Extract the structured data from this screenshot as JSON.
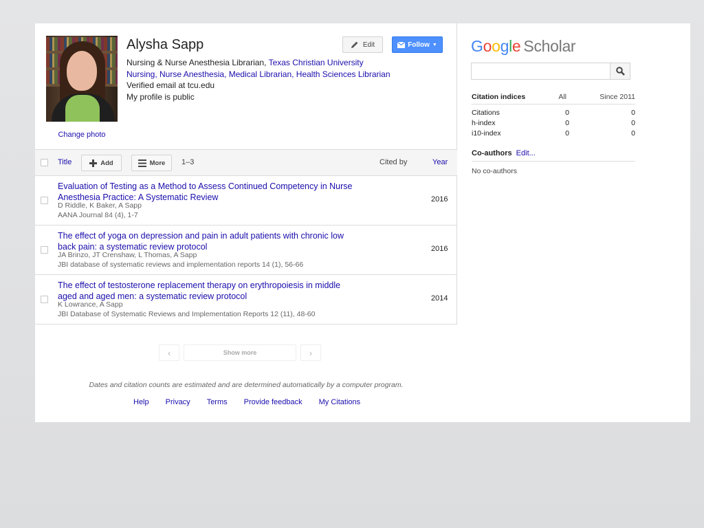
{
  "profile": {
    "name": "Alysha Sapp",
    "affiliation_prefix": "Nursing & Nurse Anesthesia Librarian, ",
    "affiliation_org": "Texas Christian University",
    "interests": "Nursing, Nurse Anesthesia, Medical Librarian, Health Sciences Librarian",
    "verified_email": "Verified email at tcu.edu",
    "visibility": "My profile is public",
    "change_photo": "Change photo"
  },
  "actions": {
    "edit_label": "Edit",
    "follow_label": "Follow"
  },
  "toolbar": {
    "title_col": "Title",
    "add_label": "Add",
    "more_label": "More",
    "range": "1–3",
    "cited_by_col": "Cited by",
    "year_col": "Year"
  },
  "articles": [
    {
      "title": "Evaluation of Testing as a Method to Assess Continued Competency in Nurse Anesthesia Practice: A Systematic Review",
      "authors": "D Riddle, K Baker, A Sapp",
      "publication": "AANA Journal 84 (4), 1-7",
      "year": "2016"
    },
    {
      "title": "The effect of yoga on depression and pain in adult patients with chronic low back pain: a systematic review protocol",
      "authors": "JA Brinzo, JT Crenshaw, L Thomas, A Sapp",
      "publication": "JBI database of systematic reviews and implementation reports 14 (1), 56-66",
      "year": "2016"
    },
    {
      "title": "The effect of testosterone replacement therapy on erythropoiesis in middle aged and aged men: a systematic review protocol",
      "authors": "K Lowrance, A Sapp",
      "publication": "JBI Database of Systematic Reviews and Implementation Reports 12 (11), 48-60",
      "year": "2014"
    }
  ],
  "pager": {
    "prev": "‹",
    "show_more": "Show more",
    "next": "›"
  },
  "disclaimer": "Dates and citation counts are estimated and are determined automatically by a computer program.",
  "footer": [
    "Help",
    "Privacy",
    "Terms",
    "Provide feedback",
    "My Citations"
  ],
  "sidebar": {
    "logo_word": "Google",
    "logo_suffix": "Scholar",
    "search_value": "",
    "citation_indices": {
      "heading": "Citation indices",
      "col_all": "All",
      "col_since": "Since 2011",
      "rows": [
        {
          "label": "Citations",
          "all": "0",
          "since": "0"
        },
        {
          "label": "h-index",
          "all": "0",
          "since": "0"
        },
        {
          "label": "i10-index",
          "all": "0",
          "since": "0"
        }
      ]
    },
    "coauthors": {
      "heading": "Co-authors",
      "edit": "Edit...",
      "empty": "No co-authors"
    }
  },
  "colors": {
    "link": "#1a0dab",
    "follow_button": "#4d90fe",
    "google_blue": "#4285f4",
    "google_red": "#ea4335",
    "google_yellow": "#fbbc05",
    "google_green": "#34a853"
  },
  "icons": {
    "edit": "pencil-icon",
    "follow": "envelope-icon",
    "add": "plus-icon",
    "more": "hamburger-icon",
    "search": "magnifier-icon"
  }
}
